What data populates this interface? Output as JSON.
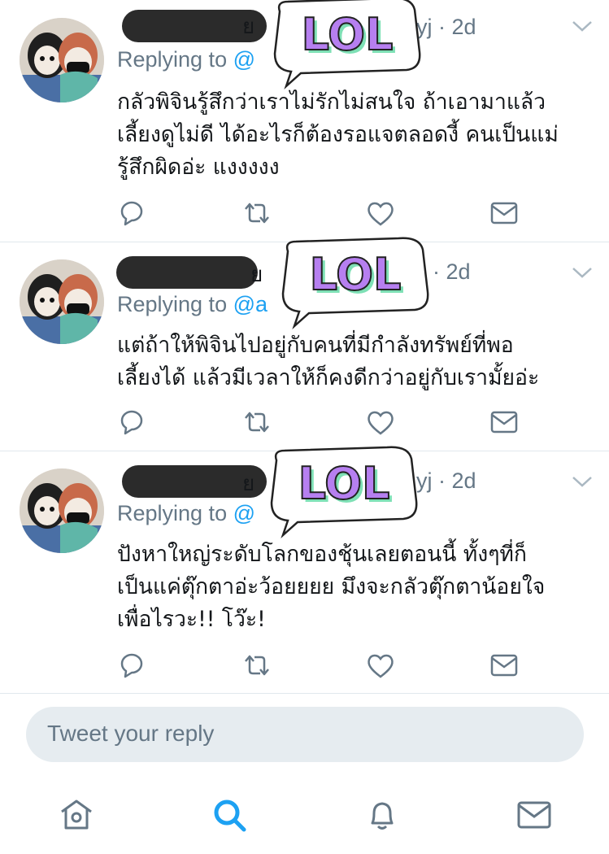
{
  "colors": {
    "accent": "#1da1f2",
    "muted": "#657786",
    "text": "#14171a",
    "divider": "#e1e8ed",
    "input_bg": "#e6ecf0",
    "sticker_green": "#7ee0b5",
    "sticker_purple": "#b67ff0"
  },
  "tweets": [
    {
      "name_suffix": "ย",
      "handle_tail": "yj",
      "time": "2d",
      "replying_label": "Replying to",
      "replying_handle": "@",
      "sticker_text": "LOL",
      "lines": [
        "กลัวพิจินรู้สึกว่าเราไม่รักไม่สนใจ ถ้าเอามาแล้ว",
        "เลี้ยงดูไม่ดี ได้อะไรก็ต้องรอแจตลอดงี้ คนเป็นแม่",
        "รู้สึกผิดอ่ะ แงงงงง"
      ]
    },
    {
      "name_suffix": "ย",
      "handle_tail": "",
      "time": "2d",
      "replying_label": "Replying to",
      "replying_handle": "@a",
      "sticker_text": "LOL",
      "lines": [
        "แต่ถ้าให้พิจินไปอยู่กับคนที่มีกำลังทรัพย์ที่พอ",
        "เลี้ยงได้ แล้วมีเวลาให้ก็คงดีกว่าอยู่กับเรามั้ยอ่ะ"
      ]
    },
    {
      "name_suffix": "ย",
      "handle_tail": "yj",
      "time": "2d",
      "replying_label": "Replying to",
      "replying_handle": "@",
      "sticker_text": "LOL",
      "lines": [
        "ปังหาใหญ่ระดับโลกของชุ้นเลยตอนนี้ ทั้งๆที่ก็",
        "เป็นแค่ตุ๊กตาอ่ะว้อยยยย มึงจะกลัวตุ๊กตาน้อยใจ",
        "เพื่อไรวะ!! โว๊ะ!"
      ]
    }
  ],
  "reply_box": {
    "placeholder": "Tweet your reply"
  },
  "tabbar": {
    "icons": [
      "home-icon",
      "search-icon",
      "notifications-icon",
      "messages-icon"
    ],
    "active": "search-icon"
  }
}
